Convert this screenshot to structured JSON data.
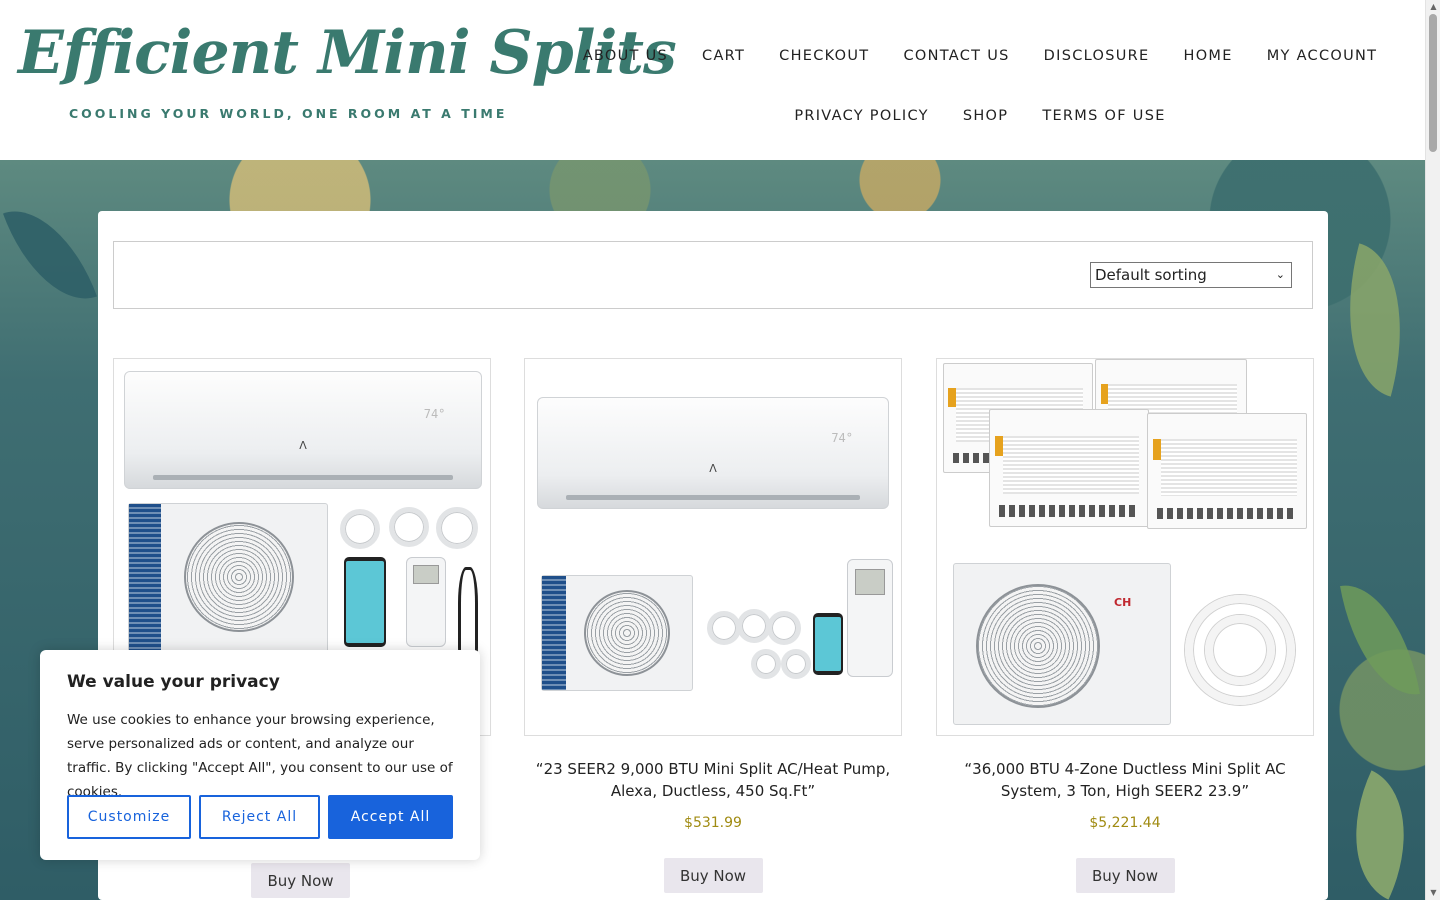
{
  "site": {
    "title": "Efficient Mini Splits",
    "tagline": "COOLING YOUR WORLD, ONE ROOM AT A TIME"
  },
  "nav": {
    "row1": [
      "ABOUT US",
      "CART",
      "CHECKOUT",
      "CONTACT US",
      "DISCLOSURE",
      "HOME",
      "MY ACCOUNT"
    ],
    "row2": [
      "PRIVACY POLICY",
      "SHOP",
      "TERMS OF USE"
    ]
  },
  "sorting": {
    "selected": "Default sorting"
  },
  "products": [
    {
      "title": "",
      "price": "",
      "button": "Buy Now",
      "display": "74°"
    },
    {
      "title": "“23 SEER2 9,000 BTU Mini Split AC/Heat Pump, Alexa, Ductless, 450 Sq.Ft”",
      "price": "$531.99",
      "button": "Buy Now",
      "display": "74°"
    },
    {
      "title": "“36,000 BTU 4-Zone Ductless Mini Split AC System, 3 Ton, High SEER2 23.9”",
      "price": "$5,221.44",
      "button": "Buy Now",
      "brand": "CH"
    }
  ],
  "cookie": {
    "title": "We value your privacy",
    "text": "We use cookies to enhance your browsing experience, serve personalized ads or content, and analyze our traffic. By clicking \"Accept All\", you consent to our use of cookies.",
    "customize": "Customize",
    "reject": "Reject All",
    "accept": "Accept All"
  },
  "colors": {
    "brand": "#3a7a6f",
    "price": "#a08b12",
    "cookie_accent": "#1863dc"
  }
}
